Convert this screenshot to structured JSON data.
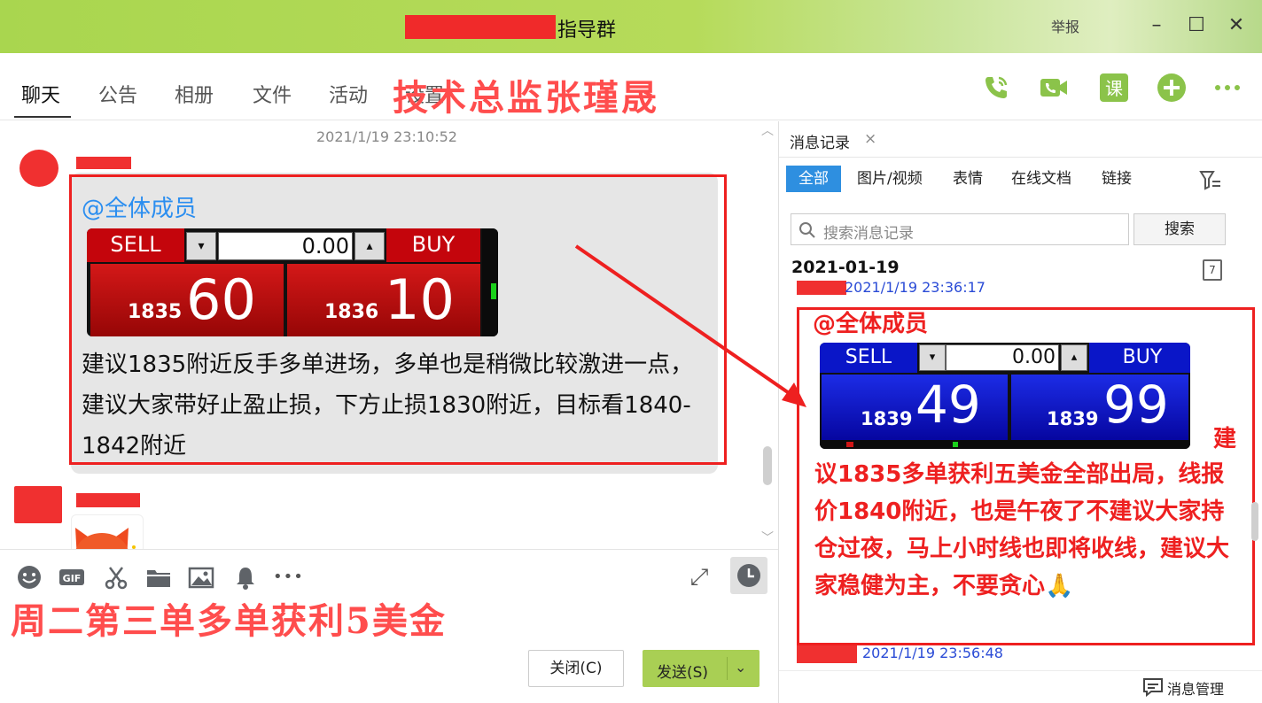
{
  "window": {
    "title": "指导群",
    "report_label": "举报",
    "min_glyph": "–",
    "max_glyph": "☐",
    "close_glyph": "✕"
  },
  "tabs": [
    {
      "label": "聊天",
      "active": true
    },
    {
      "label": "公告",
      "active": false
    },
    {
      "label": "相册",
      "active": false
    },
    {
      "label": "文件",
      "active": false
    },
    {
      "label": "活动",
      "active": false
    },
    {
      "label": "设置",
      "active": false
    }
  ],
  "header_overlay": "技术总监张瑾晟",
  "header_icons": [
    "phone-icon",
    "video-call-icon",
    "class-icon",
    "add-icon",
    "more-icon"
  ],
  "class_icon_label": "课",
  "chat": {
    "timestamp": "2021/1/19 23:10:52",
    "message": {
      "mention": "@全体成员",
      "text": "建议1835附近反手多单进场，多单也是稍微比较激进一点，建议大家带好止盈止损，下方止损1830附近，目标看1840-1842附近"
    }
  },
  "trade_widget_main": {
    "sell_label": "SELL",
    "buy_label": "BUY",
    "amount": "0.00",
    "sell_small": "1835",
    "sell_big": "60",
    "buy_small": "1836",
    "buy_big": "10",
    "color": "#c4050c"
  },
  "trade_widget_history": {
    "sell_label": "SELL",
    "buy_label": "BUY",
    "amount": "0.00",
    "sell_small": "1839",
    "sell_big": "49",
    "buy_small": "1839",
    "buy_big": "99",
    "color": "#0a16c8"
  },
  "toolbar": {
    "icons": [
      "emoji-icon",
      "gif-icon",
      "scissors-icon",
      "folder-icon",
      "image-icon",
      "bell-icon",
      "more-icon"
    ],
    "gif_label": "GIF",
    "more_glyph": "•••",
    "expand_glyph": "⤢",
    "history_glyph": "◷",
    "overlay_text": "周二第三单多单获利5美金",
    "close_button": "关闭(C)",
    "send_button": "发送(S)",
    "send_dropdown_glyph": "⌄"
  },
  "history_panel": {
    "tab_label": "消息记录",
    "tab_close_glyph": "×",
    "filters": [
      {
        "label": "全部",
        "active": true
      },
      {
        "label": "图片/视频",
        "active": false
      },
      {
        "label": "表情",
        "active": false
      },
      {
        "label": "在线文档",
        "active": false
      },
      {
        "label": "链接",
        "active": false
      }
    ],
    "search_placeholder": "搜索消息记录",
    "search_button": "搜索",
    "date": "2021-01-19",
    "calendar_label": "7",
    "entry1_time": "2021/1/19 23:36:17",
    "entry1_mention": "@全体成员",
    "entry1_text_start": "建",
    "entry1_text_rest": "议1835多单获利五美金全部出局，线报价1840附近，也是午夜了不建议大家持仓过夜，马上小时线也即将收线，建议大家稳健为主，不要贪心🙏",
    "entry2_time": "2021/1/19 23:56:48",
    "manage_label": "消息管理"
  },
  "colors": {
    "titlebar": "#b6db5a",
    "accent_blue": "#2e8fe0",
    "send_green": "#a9cf54",
    "annotation_red": "#ee2020"
  }
}
